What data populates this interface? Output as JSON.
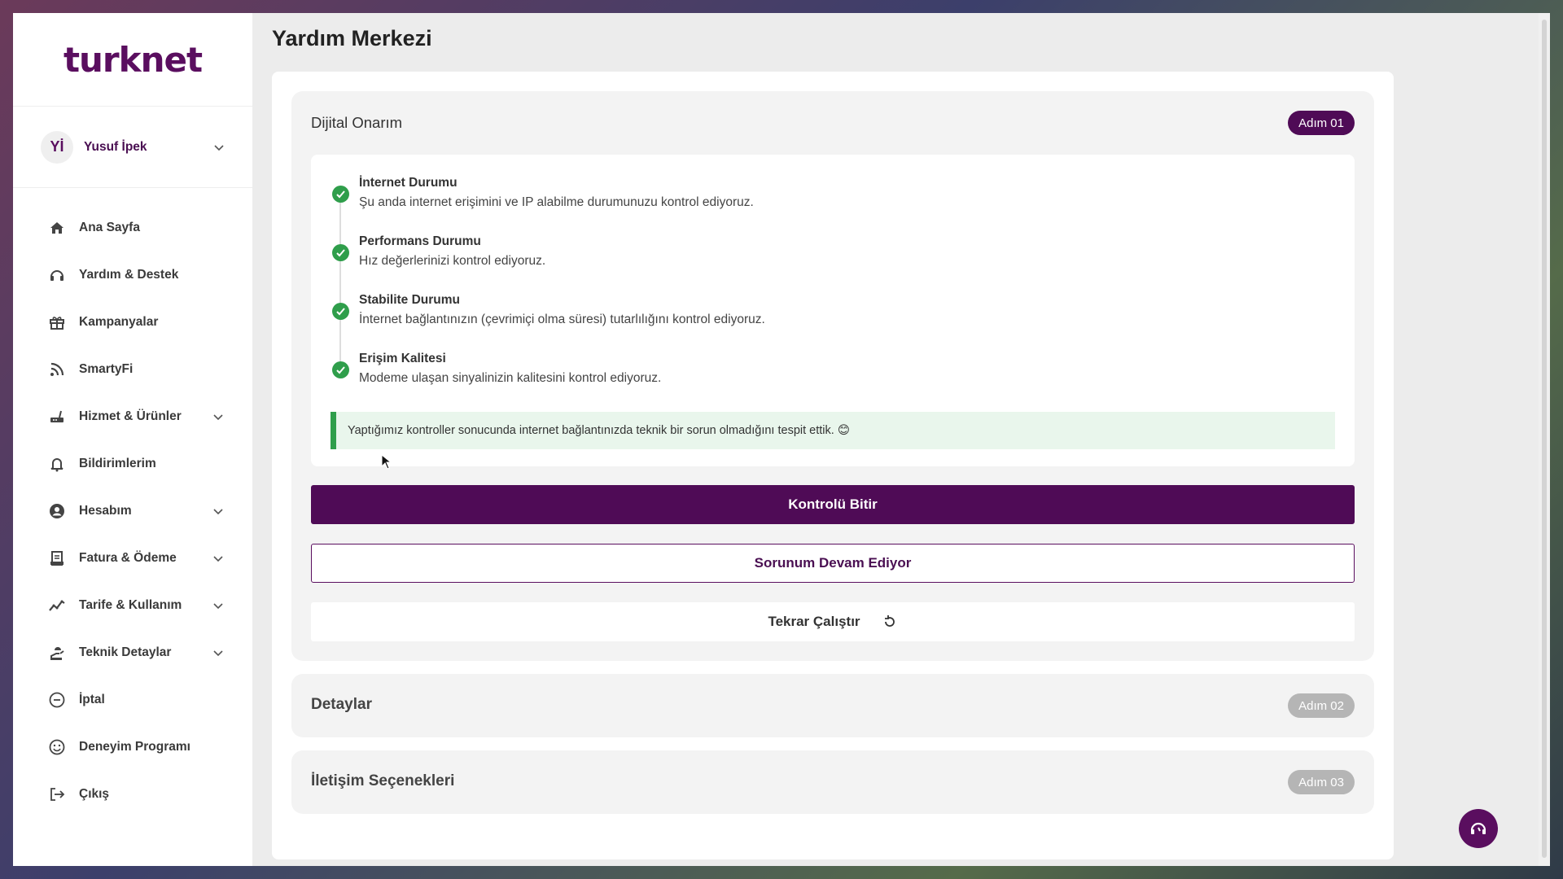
{
  "sidebar": {
    "logo": "turknet",
    "user": {
      "initials": "Yİ",
      "name": "Yusuf İpek"
    },
    "items": [
      {
        "label": "Ana Sayfa",
        "icon": "home-icon"
      },
      {
        "label": "Yardım & Destek",
        "icon": "headset-icon"
      },
      {
        "label": "Kampanyalar",
        "icon": "gift-icon"
      },
      {
        "label": "SmartyFi",
        "icon": "rss-icon"
      },
      {
        "label": "Hizmet & Ürünler",
        "icon": "router-icon"
      },
      {
        "label": "Bildirimlerim",
        "icon": "bell-icon"
      },
      {
        "label": "Hesabım",
        "icon": "user-circle-icon"
      },
      {
        "label": "Fatura & Ödeme",
        "icon": "receipt-icon"
      },
      {
        "label": "Tarife & Kullanım",
        "icon": "chart-line-icon"
      },
      {
        "label": "Teknik Detaylar",
        "icon": "technician-icon"
      },
      {
        "label": "İptal",
        "icon": "minus-circle-icon"
      },
      {
        "label": "Deneyim Programı",
        "icon": "smile-icon"
      },
      {
        "label": "Çıkış",
        "icon": "logout-icon"
      }
    ]
  },
  "main": {
    "title": "Yardım Merkezi",
    "step1": {
      "title": "Dijital Onarım",
      "badge": "Adım 01",
      "checks": [
        {
          "title": "İnternet Durumu",
          "desc": "Şu anda internet erişimini ve IP alabilme durumunuzu kontrol ediyoruz."
        },
        {
          "title": "Performans Durumu",
          "desc": "Hız değerlerinizi kontrol ediyoruz."
        },
        {
          "title": "Stabilite Durumu",
          "desc": "İnternet bağlantınızın (çevrimiçi olma süresi) tutarlılığını kontrol ediyoruz."
        },
        {
          "title": "Erişim Kalitesi",
          "desc": "Modeme ulaşan sinyalinizin kalitesini kontrol ediyoruz."
        }
      ],
      "result": "Yaptığımız kontroller sonucunda internet bağlantınızda teknik bir sorun olmadığını tespit ettik. 😊",
      "primary_button": "Kontrolü Bitir",
      "outline_button": "Sorunum Devam Ediyor",
      "rerun_button": "Tekrar Çalıştır"
    },
    "step2": {
      "title": "Detaylar",
      "badge": "Adım 02"
    },
    "step3": {
      "title": "İletişim Seçenekleri",
      "badge": "Adım 03"
    }
  },
  "colors": {
    "brand": "#4f0b56",
    "success": "#2f9e4b",
    "badge_inactive": "#b5b5b5"
  }
}
